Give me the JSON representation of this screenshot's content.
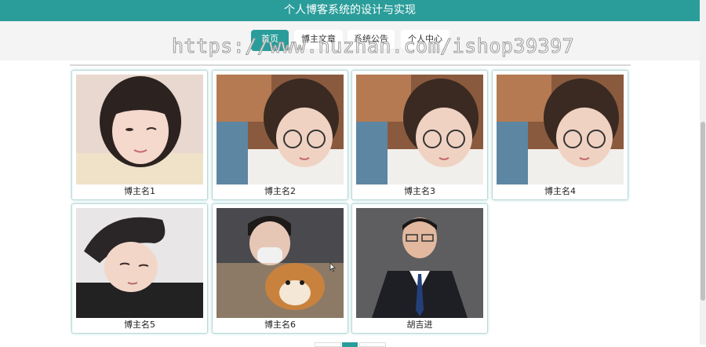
{
  "header": {
    "title": "个人博客系统的设计与实现"
  },
  "nav": {
    "items": [
      {
        "label": "首页",
        "active": true
      },
      {
        "label": "博主文章",
        "active": false
      },
      {
        "label": "系统公告",
        "active": false
      },
      {
        "label": "个人中心",
        "active": false
      }
    ]
  },
  "watermark": "https://www.huzhan.com/ishop39397",
  "bloggers": [
    {
      "name": "博主名1"
    },
    {
      "name": "博主名2"
    },
    {
      "name": "博主名3"
    },
    {
      "name": "博主名4"
    },
    {
      "name": "博主名5"
    },
    {
      "name": "博主名6"
    },
    {
      "name": "胡吉进"
    }
  ],
  "colors": {
    "accent": "#2a9d9a"
  }
}
